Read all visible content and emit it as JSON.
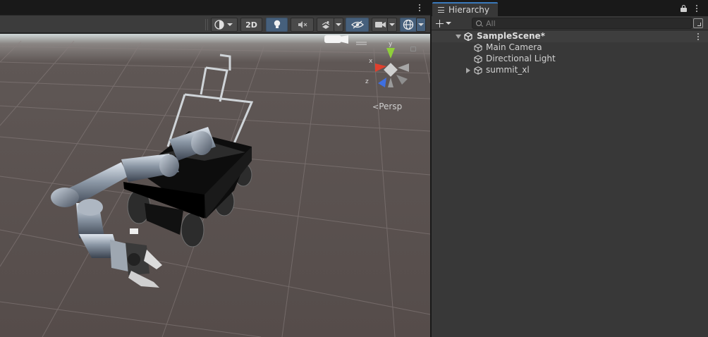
{
  "scene_view": {
    "toolbar": {
      "two_d_label": "2D"
    },
    "persp_label": "Persp",
    "gizmo": {
      "y_label": "y",
      "x_label": "x",
      "z_label": "z"
    }
  },
  "hierarchy": {
    "tab_title": "Hierarchy",
    "search_placeholder": "All",
    "scene_name": "SampleScene*",
    "items": [
      {
        "label": "Main Camera"
      },
      {
        "label": "Directional Light"
      },
      {
        "label": "summit_xl"
      }
    ]
  },
  "colors": {
    "accent": "#3a79bb",
    "toolbar_active": "#46607c",
    "panel_bg": "#383838",
    "ground": "#554c4a",
    "gizmo_y": "#8fcf3a",
    "gizmo_x": "#e0402e",
    "gizmo_z": "#3f6fe0"
  }
}
